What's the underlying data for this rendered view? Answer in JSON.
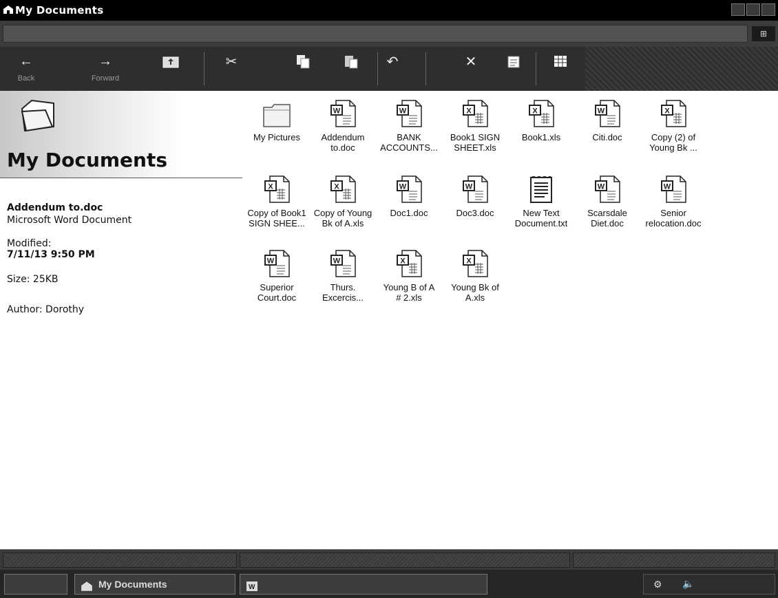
{
  "window": {
    "title": "My Documents"
  },
  "toolbar": {
    "back_label": "Back",
    "forward_label": "Forward"
  },
  "left_pane": {
    "heading": "My Documents",
    "selected_name": "Addendum to.doc",
    "selected_type": "Microsoft Word Document",
    "modified_label": "Modified:",
    "modified_value": "7/11/13 9:50 PM",
    "size_text": "Size: 25KB",
    "author_text": "Author: Dorothy"
  },
  "files": [
    {
      "line1": "My Pictures",
      "line2": "",
      "icon": "folder-icon"
    },
    {
      "line1": "Addendum",
      "line2": "to.doc",
      "icon": "word-doc-icon"
    },
    {
      "line1": "BANK",
      "line2": "ACCOUNTS...",
      "icon": "word-doc-icon"
    },
    {
      "line1": "Book1 SIGN",
      "line2": "SHEET.xls",
      "icon": "excel-sheet-icon"
    },
    {
      "line1": "Book1.xls",
      "line2": "",
      "icon": "excel-sheet-icon"
    },
    {
      "line1": "Citi.doc",
      "line2": "",
      "icon": "word-doc-icon"
    },
    {
      "line1": "Copy (2) of",
      "line2": "Young Bk ...",
      "icon": "excel-sheet-icon"
    },
    {
      "line1": "Copy of Book1",
      "line2": "SIGN SHEE...",
      "icon": "excel-sheet-icon"
    },
    {
      "line1": "Copy of Young",
      "line2": "Bk of A.xls",
      "icon": "excel-sheet-icon"
    },
    {
      "line1": "Doc1.doc",
      "line2": "",
      "icon": "word-doc-icon"
    },
    {
      "line1": "Doc3.doc",
      "line2": "",
      "icon": "word-doc-icon"
    },
    {
      "line1": "New Text",
      "line2": "Document.txt",
      "icon": "text-file-icon"
    },
    {
      "line1": "Scarsdale",
      "line2": "Diet.doc",
      "icon": "word-doc-icon"
    },
    {
      "line1": "Senior",
      "line2": "relocation.doc",
      "icon": "word-doc-icon"
    },
    {
      "line1": "Superior",
      "line2": "Court.doc",
      "icon": "word-doc-icon"
    },
    {
      "line1": "Thurs.",
      "line2": "Excercis...",
      "icon": "word-doc-icon"
    },
    {
      "line1": "Young B of A",
      "line2": "# 2.xls",
      "icon": "excel-sheet-icon"
    },
    {
      "line1": "Young Bk of",
      "line2": "A.xls",
      "icon": "excel-sheet-icon"
    }
  ],
  "taskbar": {
    "active_task": "My Documents"
  }
}
